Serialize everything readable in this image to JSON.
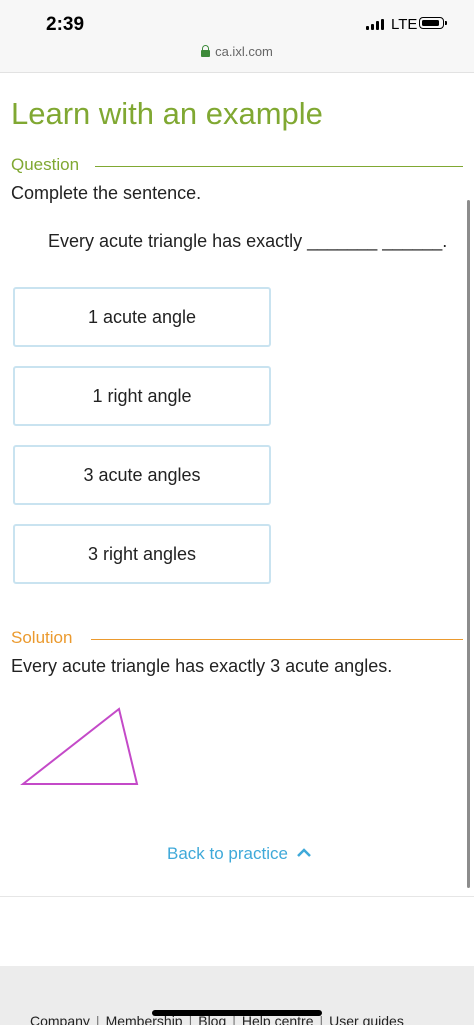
{
  "status": {
    "time": "2:39",
    "network": "LTE"
  },
  "browser": {
    "url": "ca.ixl.com"
  },
  "page": {
    "title": "Learn with an example",
    "question_label": "Question",
    "prompt": "Complete the sentence.",
    "sentence": "Every acute triangle has exactly _______ ______.",
    "choices": [
      "1 acute angle",
      "1 right angle",
      "3 acute angles",
      "3 right angles"
    ],
    "solution_label": "Solution",
    "solution_text": "Every acute triangle has exactly 3 acute angles.",
    "back_link": "Back to practice"
  },
  "footer": {
    "links": [
      "Company",
      "Membership",
      "Blog",
      "Help centre",
      "User guides"
    ]
  },
  "colors": {
    "green": "#80a832",
    "orange": "#eb9a2e",
    "link": "#3fa9d9",
    "choice_border": "#c9e3f0",
    "triangle": "#c44ac8"
  }
}
